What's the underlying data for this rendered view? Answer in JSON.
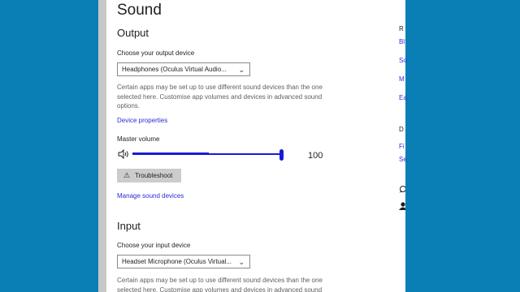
{
  "page": {
    "title": "Sound"
  },
  "output": {
    "heading": "Output",
    "device_label": "Choose your output device",
    "device_value": "Headphones (Oculus Virtual Audio...",
    "help_text": "Certain apps may be set up to use different sound devices than the one selected here. Customise app volumes and devices in advanced sound options.",
    "device_properties_link": "Device properties",
    "master_volume_label": "Master volume",
    "volume_value": "100",
    "volume_level_fraction": 1.0,
    "troubleshoot_label": "Troubleshoot",
    "manage_devices_link": "Manage sound devices"
  },
  "input": {
    "heading": "Input",
    "device_label": "Choose your input device",
    "device_value": "Headset Microphone (Oculus Virtual...",
    "help_text": "Certain apps may be set up to use different sound devices than the one selected here. Customise app volumes and devices in advanced sound"
  },
  "side_panel": {
    "heading_1": "R",
    "links_1": [
      "Bl",
      "So",
      "M",
      "Ea"
    ],
    "heading_2": "D",
    "links_2": [
      "Fi",
      "Se"
    ]
  },
  "colors": {
    "desktop": "#0a7fb5",
    "accent": "#1a1ad6",
    "link": "#2b2bd6"
  },
  "icons": {
    "speaker": "speaker-icon",
    "warning": "warning-icon",
    "chevron": "chevron-down-icon",
    "help": "help-icon",
    "feedback": "feedback-icon"
  }
}
